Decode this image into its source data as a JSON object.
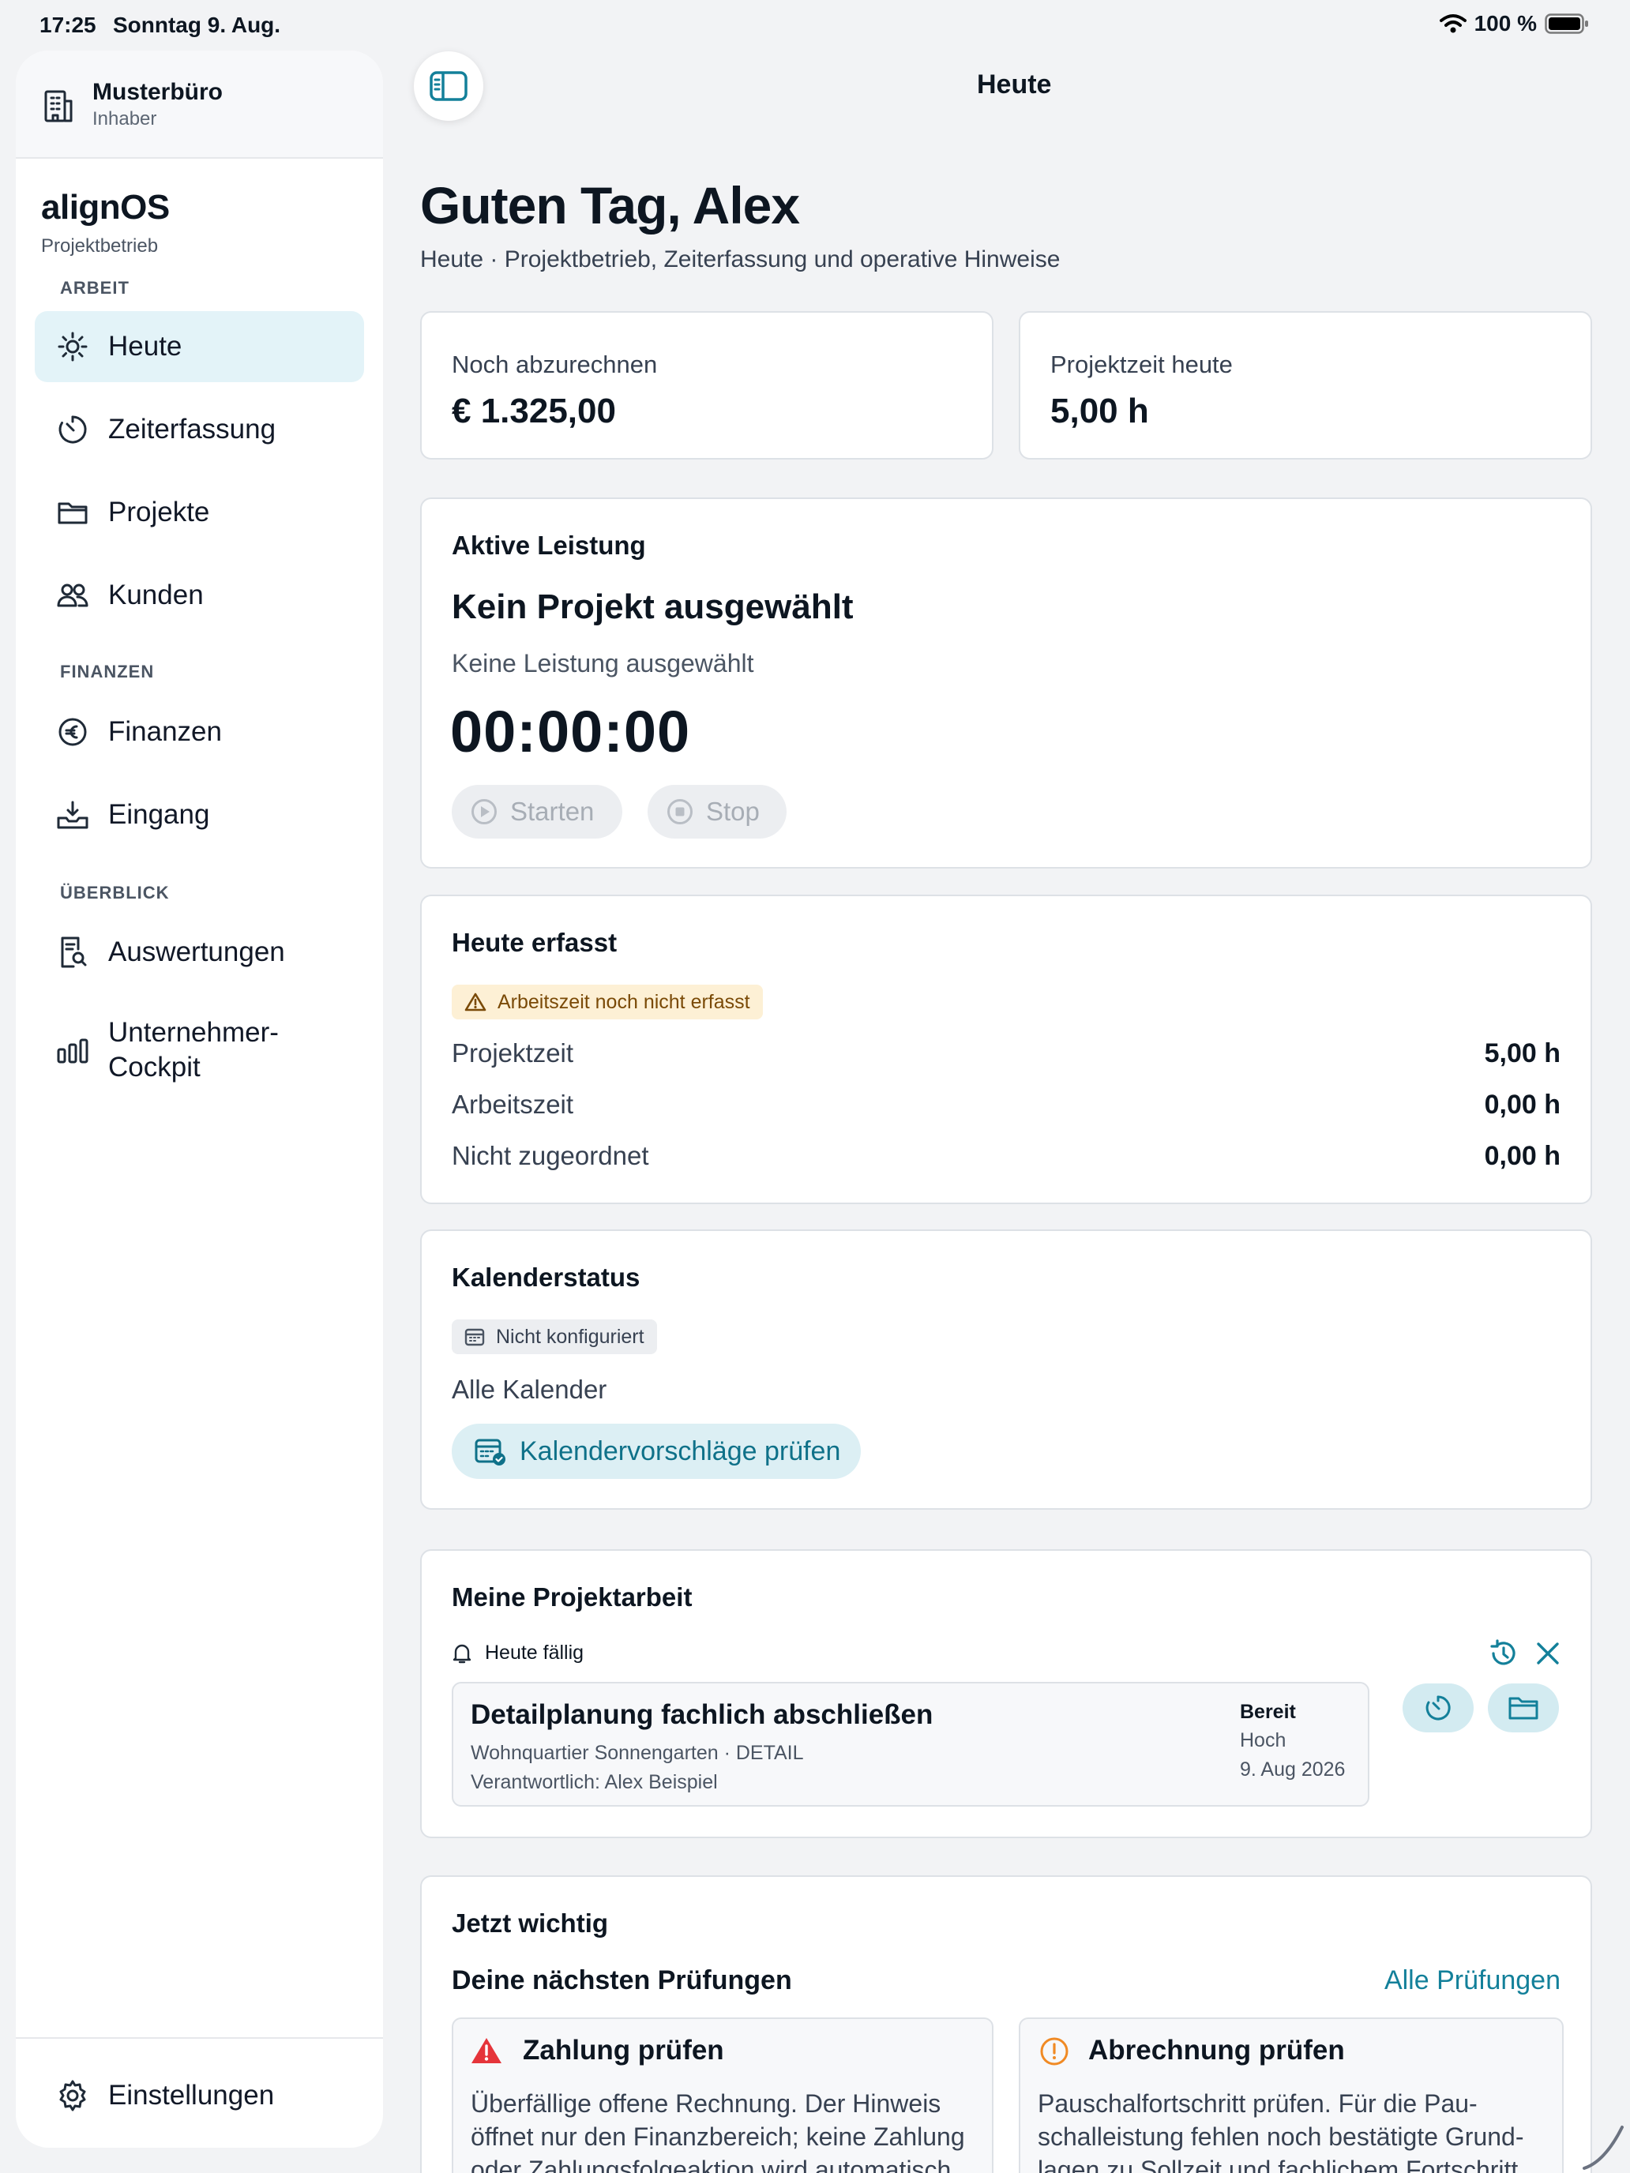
{
  "status_bar": {
    "time": "17:25",
    "date": "Sonntag 9. Aug.",
    "battery": "100 %"
  },
  "sidebar": {
    "org_name": "Musterbüro",
    "org_role": "Inhaber",
    "app_name": "alignOS",
    "app_subtitle": "Projektbetrieb",
    "sections": [
      "ARBEIT",
      "FINANZEN",
      "ÜBERBLICK"
    ],
    "items": [
      {
        "label": "Heute",
        "icon": "sun-icon",
        "active": true
      },
      {
        "label": "Zeiterfassung",
        "icon": "timer-icon"
      },
      {
        "label": "Projekte",
        "icon": "folder-icon"
      },
      {
        "label": "Kunden",
        "icon": "people-icon"
      },
      {
        "label": "Finanzen",
        "icon": "euro-icon"
      },
      {
        "label": "Eingang",
        "icon": "inbox-icon"
      },
      {
        "label": "Auswertungen",
        "icon": "report-icon"
      },
      {
        "label_line1": "Unternehmer-",
        "label_line2": "Cockpit",
        "icon": "bar-chart-icon"
      }
    ],
    "settings_label": "Einstellungen"
  },
  "header": {
    "title": "Heute"
  },
  "greeting": {
    "title": "Guten Tag, Alex",
    "subtitle": "Heute · Projektbetrieb, Zeiterfassung und operative Hinweise"
  },
  "kpis": [
    {
      "label": "Noch abzurechnen",
      "value": "€ 1.325,00"
    },
    {
      "label": "Projektzeit heute",
      "value": "5,00 h"
    }
  ],
  "active_service": {
    "title": "Aktive Leistung",
    "project": "Kein Projekt ausgewählt",
    "service": "Keine Leistung ausgewählt",
    "timer": "00:00:00",
    "start_label": "Starten",
    "stop_label": "Stop"
  },
  "today_logged": {
    "title": "Heute erfasst",
    "warning": "Arbeitszeit noch nicht erfasst",
    "rows": [
      {
        "label": "Projektzeit",
        "value": "5,00 h"
      },
      {
        "label": "Arbeitszeit",
        "value": "0,00 h"
      },
      {
        "label": "Nicht zugeordnet",
        "value": "0,00 h"
      }
    ]
  },
  "calendar_status": {
    "title": "Kalenderstatus",
    "badge": "Nicht konfiguriert",
    "scope": "Alle Kalender",
    "button": "Kalendervorschläge prüfen"
  },
  "my_project_work": {
    "title": "Meine Projektarbeit",
    "due_label": "Heute fällig",
    "task": {
      "title": "Detailplanung fachlich abschließen",
      "meta": "Wohnquartier Sonnengarten · DETAIL",
      "owner": "Verantwortlich: Alex Beispiel",
      "status": "Bereit",
      "priority": "Hoch",
      "date": "9. Aug 2026"
    }
  },
  "important": {
    "title": "Jetzt wichtig",
    "subtitle": "Deine nächsten Prüfungen",
    "all_link": "Alle Prüfungen",
    "checks": [
      {
        "title": "Zahlung prüfen",
        "text": "Überfällige offene Rechnung. Der Hinweis öffnet nur den Finanzbereich; keine Zahlung oder Zahlungsfolgeaktion wird automatisch",
        "severity_color": "#e5343a"
      },
      {
        "title": "Abrechnung prüfen",
        "text": "Pauschalfortschritt prüfen. Für die Pau-schalleistung fehlen noch bestätigte Grund-lagen zu Sollzeit und fachlichem Fortschritt",
        "severity_color": "#f08a24"
      }
    ]
  },
  "colors": {
    "accent": "#13809a",
    "active_nav": "#e3f3f8",
    "warning_bg": "#fdf0d5",
    "warning_text": "#7a4a07"
  }
}
